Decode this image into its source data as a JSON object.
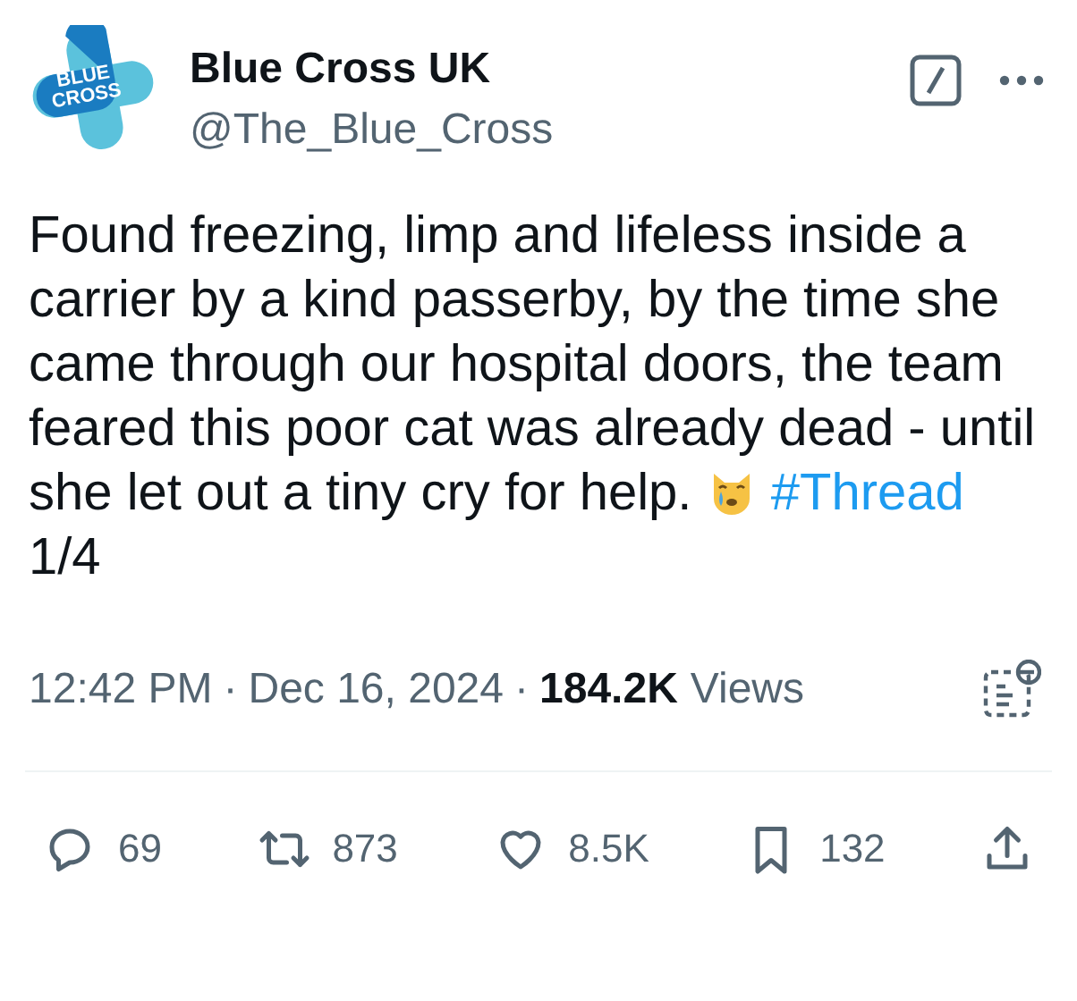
{
  "author": {
    "logo_text": [
      "BLUE",
      "CROSS"
    ],
    "name": "Blue Cross UK",
    "handle": "@The_Blue_Cross"
  },
  "body": {
    "text": "Found freezing, limp and lifeless inside a carrier by a kind passerby, by the time she came through our hospital doors, the team feared this poor cat was already dead - until she let out a tiny cry for help.",
    "hashtag": "#Thread",
    "suffix": "1/4"
  },
  "meta": {
    "time": "12:42 PM",
    "separator_1": "·",
    "date": "Dec 16, 2024",
    "separator_2": "·",
    "views_count": "184.2K",
    "views_label": "Views"
  },
  "actions": [
    {
      "kind": "reply",
      "count": "69"
    },
    {
      "kind": "repost",
      "count": "873"
    },
    {
      "kind": "like",
      "count": "8.5K"
    },
    {
      "kind": "bookmark",
      "count": "132"
    },
    {
      "kind": "share"
    }
  ]
}
